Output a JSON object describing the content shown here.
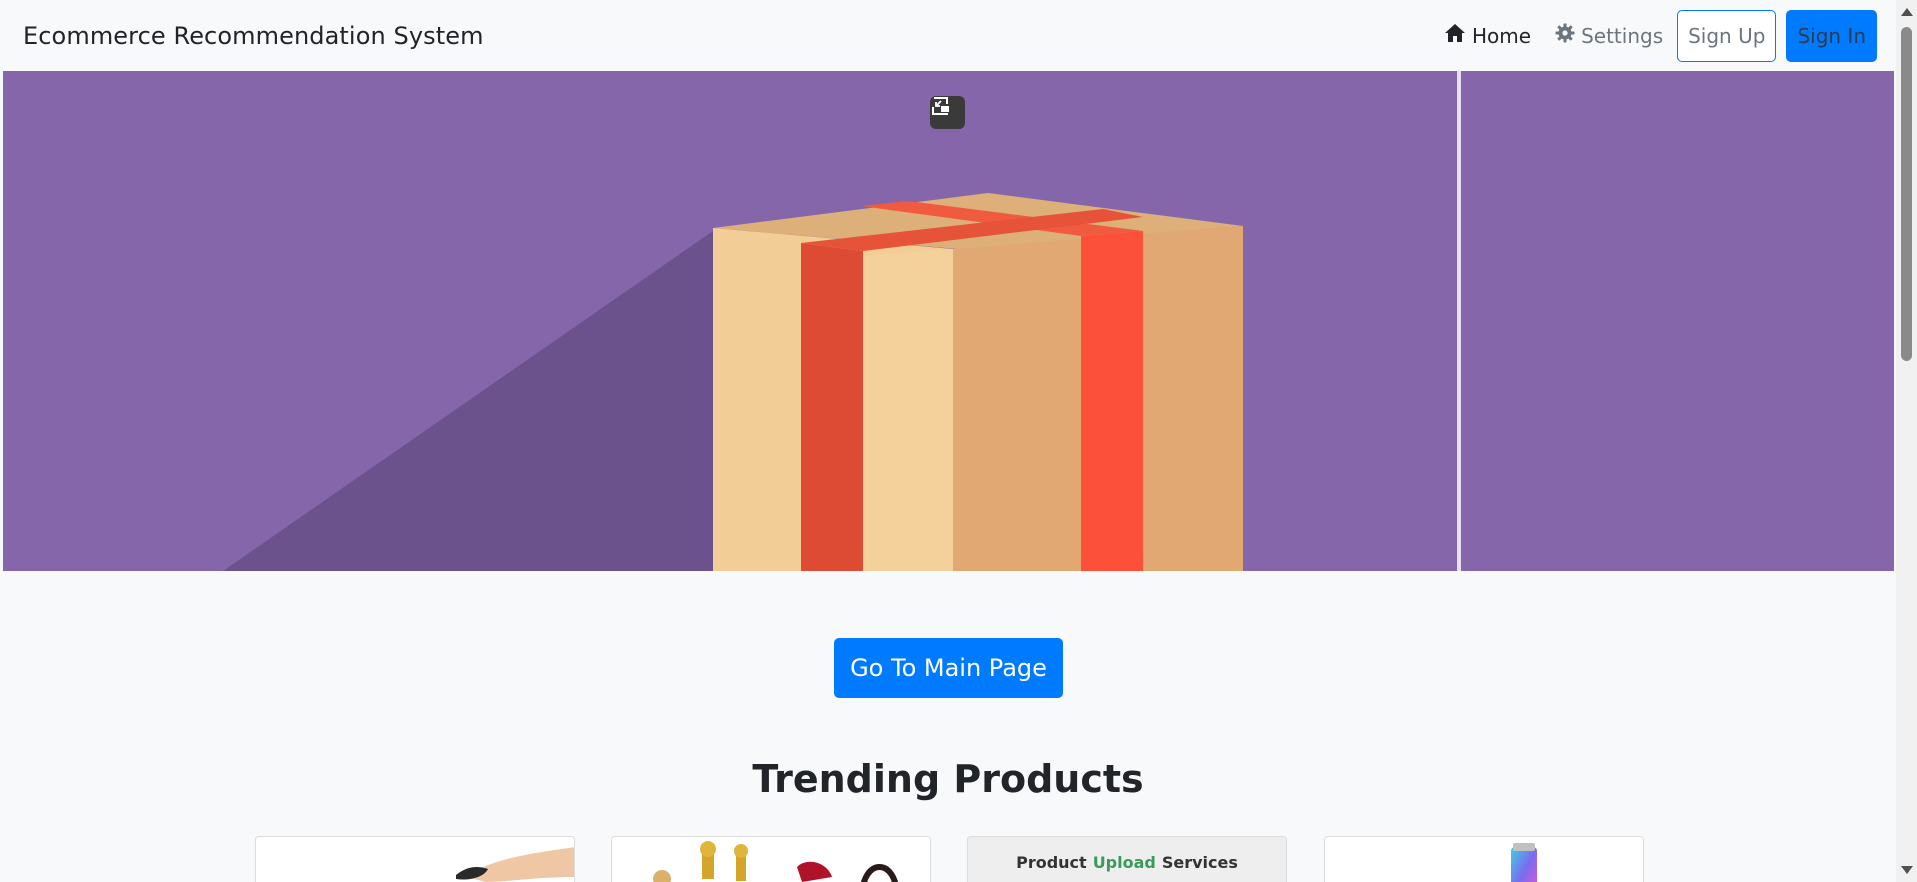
{
  "app": {
    "brand": "Ecommerce Recommendation System"
  },
  "nav": {
    "home_label": "Home",
    "settings_label": "Settings",
    "signup_label": "Sign Up",
    "signin_label": "Sign In"
  },
  "hero": {
    "pip_icon": "picture-in-picture-icon"
  },
  "main": {
    "go_button_label": "Go To Main Page",
    "section_title": "Trending Products"
  },
  "products": {
    "card3_banner_pre": "Product",
    "card3_banner_hl": "Upload",
    "card3_banner_post": "Services"
  },
  "colors": {
    "primary": "#007bff",
    "hero_bg": "#8566ab",
    "page_bg": "#f8f9fa"
  }
}
